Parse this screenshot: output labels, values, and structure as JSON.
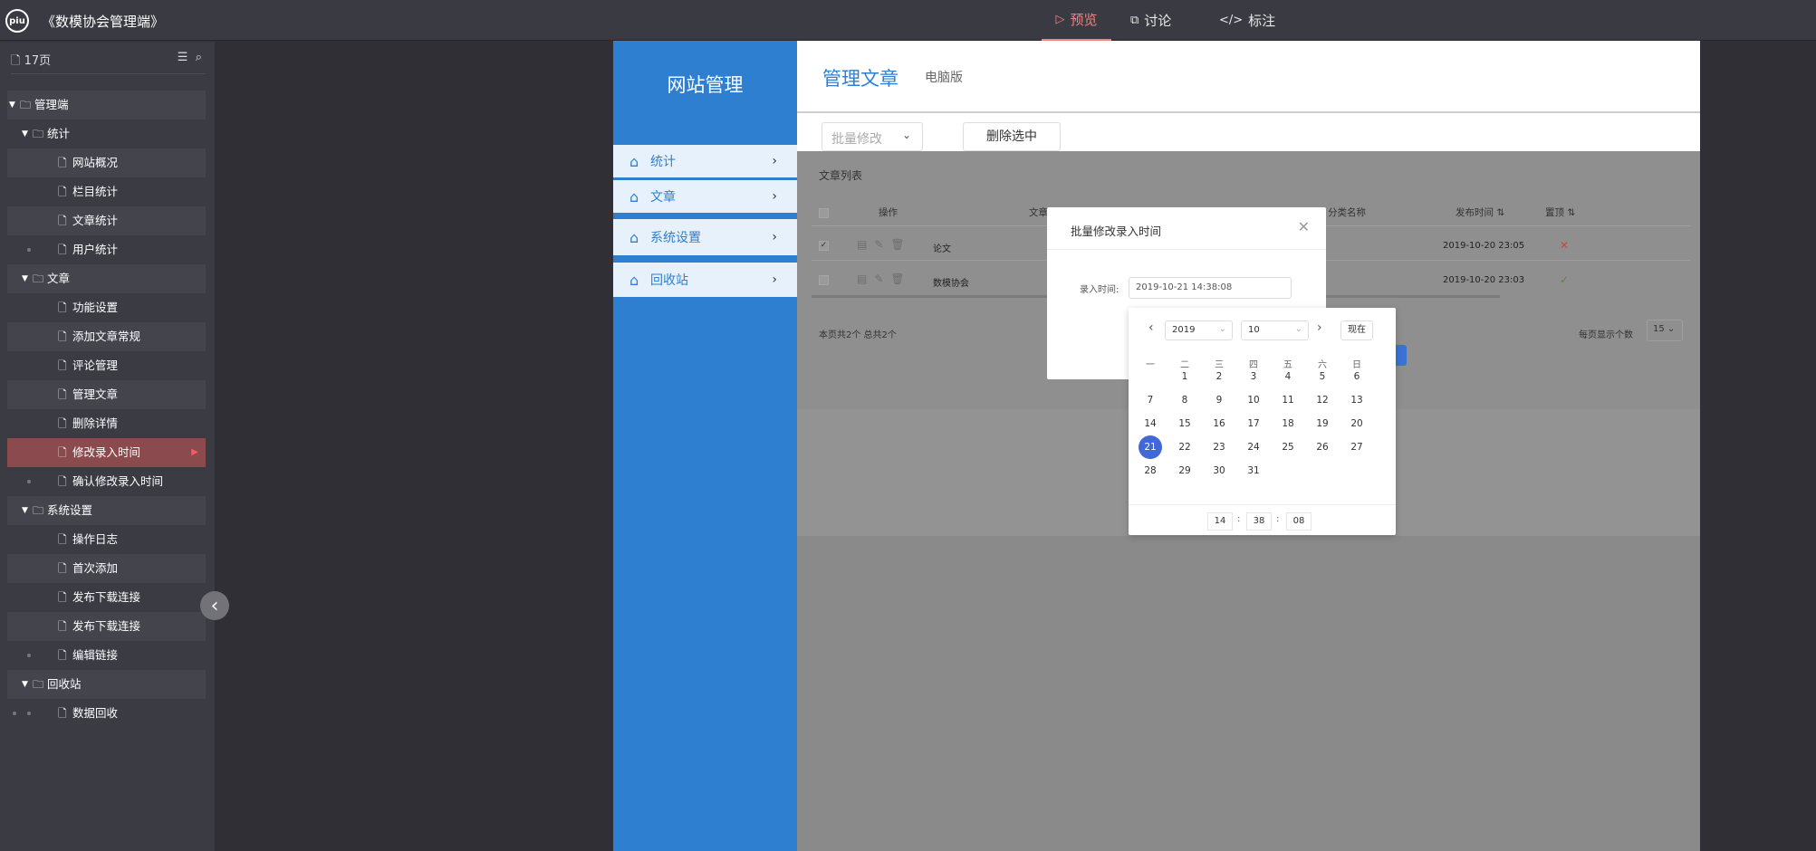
{
  "app": {
    "logo_text": "piu",
    "title": "《数模协会管理端》"
  },
  "top_tabs": [
    {
      "icon": "play-icon",
      "glyph": "▷",
      "label": "预览"
    },
    {
      "icon": "chat-icon",
      "glyph": "⧉",
      "label": "讨论"
    },
    {
      "icon": "code-icon",
      "glyph": "</>",
      "label": "标注"
    }
  ],
  "sidebar": {
    "page_count": "17页",
    "tree": [
      {
        "label": "管理端",
        "type": "folder",
        "level": 0
      },
      {
        "label": "统计",
        "type": "folder",
        "level": 1
      },
      {
        "label": "网站概况",
        "type": "page",
        "level": 2
      },
      {
        "label": "栏目统计",
        "type": "page",
        "level": 2
      },
      {
        "label": "文章统计",
        "type": "page",
        "level": 2
      },
      {
        "label": "用户统计",
        "type": "page",
        "level": 2
      },
      {
        "label": "文章",
        "type": "folder",
        "level": 1
      },
      {
        "label": "功能设置",
        "type": "page",
        "level": 2
      },
      {
        "label": "添加文章常规",
        "type": "page",
        "level": 2
      },
      {
        "label": "评论管理",
        "type": "page",
        "level": 2
      },
      {
        "label": "管理文章",
        "type": "page",
        "level": 2
      },
      {
        "label": "删除详情",
        "type": "page",
        "level": 2
      },
      {
        "label": "修改录入时间",
        "type": "page",
        "level": 2,
        "selected": true
      },
      {
        "label": "确认修改录入时间",
        "type": "page",
        "level": 2
      },
      {
        "label": "系统设置",
        "type": "folder",
        "level": 1
      },
      {
        "label": "操作日志",
        "type": "page",
        "level": 2
      },
      {
        "label": "首次添加",
        "type": "page",
        "level": 2
      },
      {
        "label": "发布下载连接",
        "type": "page",
        "level": 2
      },
      {
        "label": "发布下载连接",
        "type": "page",
        "level": 2
      },
      {
        "label": "编辑链接",
        "type": "page",
        "level": 2
      },
      {
        "label": "回收站",
        "type": "folder",
        "level": 1
      },
      {
        "label": "数据回收",
        "type": "page",
        "level": 2
      }
    ]
  },
  "prototype": {
    "brand": "网站管理",
    "nav": [
      "统计",
      "文章",
      "系统设置",
      "回收站"
    ],
    "page_title": "管理文章",
    "page_sub": "电脑版",
    "batch_select": "批量修改",
    "delete_button": "删除选中",
    "list_title": "文章列表",
    "columns": [
      "操作",
      "文章",
      "分类名称",
      "发布时间",
      "置顶"
    ],
    "rows": [
      {
        "checked": true,
        "title": "论文",
        "date": "2019-10-20 23:05",
        "top": "✕"
      },
      {
        "checked": false,
        "title": "数模协会",
        "date": "2019-10-20 23:03",
        "top": "✓"
      }
    ],
    "footer_left": "本页共2个  总共2个",
    "footer_right": "每页显示个数",
    "page_size": "15"
  },
  "dialog": {
    "title": "批量修改录入时间",
    "field_label": "录入时间:",
    "field_value": "2019-10-21 14:38:08"
  },
  "calendar": {
    "year": "2019",
    "month": "10",
    "now_label": "现在",
    "weekdays": [
      "一",
      "二",
      "三",
      "四",
      "五",
      "六",
      "日"
    ],
    "first_weekday_index": 1,
    "days_in_month": 31,
    "selected_day": 21,
    "hour": "14",
    "minute": "38",
    "second": "08"
  },
  "colors": {
    "accent_tab": "#f3837f",
    "nav_blue": "#2f7fd0",
    "selected_day": "#4267d6",
    "selected_tree": "#8b4a4d"
  }
}
